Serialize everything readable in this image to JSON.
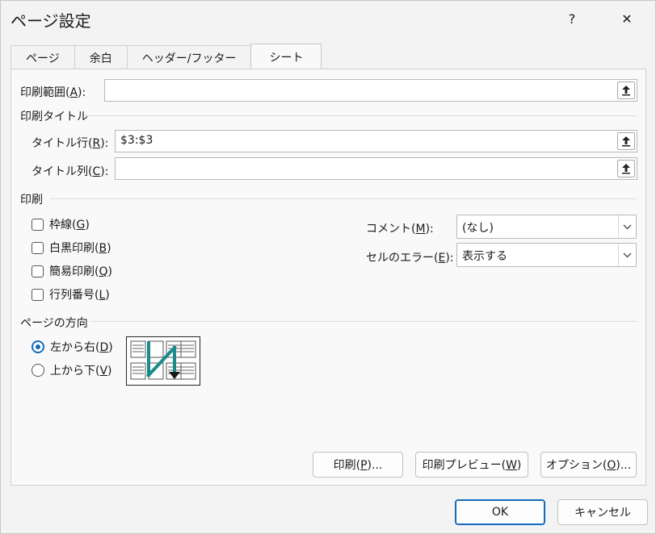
{
  "dialog": {
    "title": "ページ設定",
    "help_label": "?",
    "close_label": "✕"
  },
  "tabs": [
    {
      "label": "ページ"
    },
    {
      "label": "余白"
    },
    {
      "label": "ヘッダー/フッター"
    },
    {
      "label": "シート",
      "active": true
    }
  ],
  "print_area": {
    "label": "印刷範囲(",
    "key": "A",
    "suffix": "):",
    "value": ""
  },
  "print_titles": {
    "group_label": "印刷タイトル",
    "rows": {
      "label": "タイトル行(",
      "key": "R",
      "suffix": "):",
      "value": "$3:$3"
    },
    "cols": {
      "label": "タイトル列(",
      "key": "C",
      "suffix": "):",
      "value": ""
    }
  },
  "print": {
    "group_label": "印刷",
    "checkboxes": [
      {
        "label": "枠線(",
        "key": "G",
        "suffix": ")",
        "checked": false
      },
      {
        "label": "白黒印刷(",
        "key": "B",
        "suffix": ")",
        "checked": false
      },
      {
        "label": "簡易印刷(",
        "key": "Q",
        "suffix": ")",
        "checked": false
      },
      {
        "label": "行列番号(",
        "key": "L",
        "suffix": ")",
        "checked": false
      }
    ],
    "comments": {
      "label": "コメント(",
      "key": "M",
      "suffix": "):",
      "value": "(なし)"
    },
    "cell_errors": {
      "label": "セルのエラー(",
      "key": "E",
      "suffix": "):",
      "value": "表示する"
    }
  },
  "page_order": {
    "group_label": "ページの方向",
    "options": [
      {
        "label": "左から右(",
        "key": "D",
        "suffix": ")",
        "selected": true
      },
      {
        "label": "上から下(",
        "key": "V",
        "suffix": ")",
        "selected": false
      }
    ]
  },
  "panel_buttons": {
    "print": {
      "label": "印刷(",
      "key": "P",
      "suffix": ")..."
    },
    "preview": {
      "label": "印刷プレビュー(",
      "key": "W",
      "suffix": ")"
    },
    "options": {
      "label": "オプション(",
      "key": "O",
      "suffix": ")..."
    }
  },
  "footer": {
    "ok_label": "OK",
    "cancel_label": "キャンセル"
  },
  "colors": {
    "accent": "#0f6cbd",
    "background": "#f3f3f3",
    "panel": "#f9f9f9",
    "diagram_arrow": "#1a8a8a"
  },
  "icons": [
    "help-icon",
    "close-icon",
    "collapse-dialog-icon",
    "chevron-down-icon",
    "page-order-diagram"
  ]
}
